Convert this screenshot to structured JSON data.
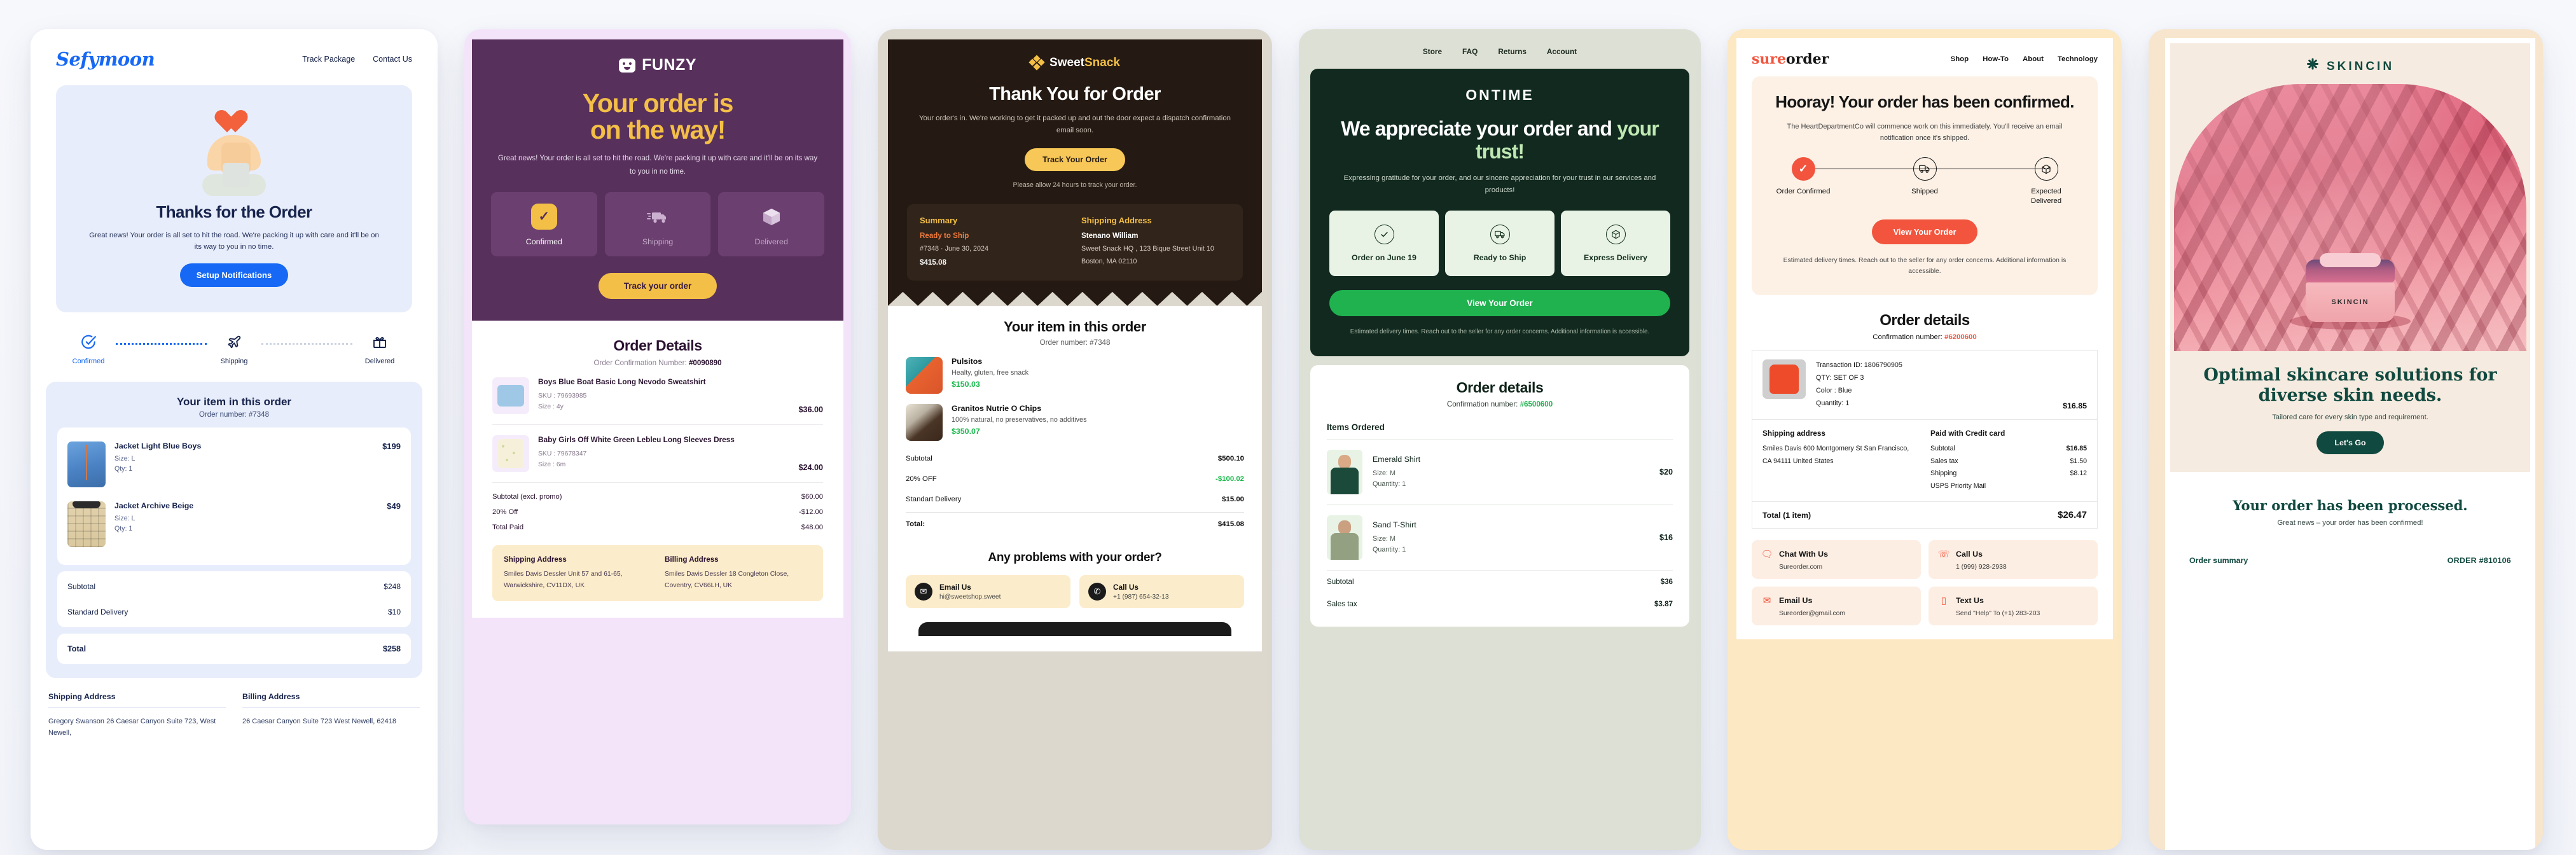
{
  "cards": [
    {
      "brand": "Sefymoon",
      "nav": [
        "Track Package",
        "Contact Us"
      ],
      "hero": {
        "title": "Thanks for the Order",
        "subtitle": "Great news! Your order is all set to hit the road. We're packing it up with care and it'll be on its way to you in no time.",
        "cta": "Setup Notifications"
      },
      "tracker": [
        {
          "label": "Confirmed",
          "icon": "check-circle-icon",
          "state": "active"
        },
        {
          "label": "Shipping",
          "icon": "airplane-icon",
          "state": "pending"
        },
        {
          "label": "Delivered",
          "icon": "gift-icon",
          "state": "pending"
        }
      ],
      "items_section": {
        "title": "Your item in this order",
        "order_number": "Order number: #7348",
        "items": [
          {
            "name": "Jacket Light Blue Boys",
            "size": "Size: L",
            "qty": "Qty: 1",
            "price": "$199"
          },
          {
            "name": "Jacket Archive Beige",
            "size": "Size: L",
            "qty": "Qty: 1",
            "price": "$49"
          }
        ],
        "summary": [
          {
            "label": "Subtotal",
            "value": "$248"
          },
          {
            "label": "Standard Delivery",
            "value": "$10"
          }
        ],
        "total": {
          "label": "Total",
          "value": "$258"
        }
      },
      "addresses": {
        "shipping_heading": "Shipping Address",
        "shipping_body": "Gregory Swanson 26 Caesar Canyon Suite 723, West Newell,",
        "billing_heading": "Billing Address",
        "billing_body": "26 Caesar Canyon Suite 723 West Newell, 62418"
      }
    },
    {
      "brand": "FUNZY",
      "hero": {
        "title_line1": "Your order is",
        "title_line2": "on the way!",
        "subtitle": "Great news! Your order is all set to hit the road. We're packing it up with care and it'll be on its way to you in no time.",
        "cta": "Track your order"
      },
      "steps": [
        {
          "label": "Confirmed",
          "icon": "check-square-icon",
          "state": "active"
        },
        {
          "label": "Shipping",
          "icon": "truck-icon",
          "state": "pending"
        },
        {
          "label": "Delivered",
          "icon": "box-icon",
          "state": "pending"
        }
      ],
      "details": {
        "title": "Order Details",
        "confirmation_label": "Order Confirmation Number:",
        "confirmation_number": "#0090890",
        "items": [
          {
            "name": "Boys Blue Boat Basic Long Nevodo Sweatshirt",
            "sku": "SKU : 79693985",
            "size": "Size : 4y",
            "price": "$36.00"
          },
          {
            "name": "Baby Girls Off White Green Lebleu Long Sleeves Dress",
            "sku": "SKU : 79678347",
            "size": "Size : 6m",
            "price": "$24.00"
          }
        ],
        "summary": [
          {
            "label": "Subtotal (excl. promo)",
            "value": "$60.00"
          },
          {
            "label": "20% Off",
            "value": "-$12.00"
          },
          {
            "label": "Total Paid",
            "value": "$48.00"
          }
        ]
      },
      "addresses": {
        "shipping_heading": "Shipping Address",
        "shipping_body": "Smiles Davis Dessler Unit 57 and 61-65, Warwickshire, CV11DX, UK",
        "billing_heading": "Billing Address",
        "billing_body": "Smiles Davis Dessler 18 Congleton Close, Coventry, CV66LH, UK"
      }
    },
    {
      "brand_part1": "Sweet",
      "brand_part2": "Snack",
      "hero": {
        "title": "Thank You for Order",
        "subtitle": "Your order's in. We're working to get it packed up and out the door expect a dispatch confirmation email soon.",
        "cta": "Track Your Order",
        "note": "Please allow 24 hours to track your order."
      },
      "panel": {
        "summary_heading": "Summary",
        "status": "Ready to Ship",
        "order_line": "#7348 · June 30, 2024",
        "amount": "$415.08",
        "shipping_heading": "Shipping Address",
        "recipient": "Stenano William",
        "address_line1": "Sweet Snack HQ , 123 Bique Street Unit 10",
        "address_line2": "Boston, MA 02110"
      },
      "items_section": {
        "title": "Your item in this order",
        "order_number": "Order number: #7348",
        "items": [
          {
            "name": "Pulsitos",
            "desc": "Healty, gluten, free snack",
            "price": "$150.03"
          },
          {
            "name": "Granitos Nutrie O Chips",
            "desc": "100% natural, no preservatives, no additives",
            "price": "$350.07"
          }
        ],
        "summary": [
          {
            "label": "Subtotal",
            "value": "$500.10",
            "green": false
          },
          {
            "label": "20% OFF",
            "value": "-$100.02",
            "green": true
          },
          {
            "label": "Standart Delivery",
            "value": "$15.00",
            "green": false
          }
        ],
        "total": {
          "label": "Total:",
          "value": "$415.08"
        }
      },
      "help": {
        "title": "Any problems with your order?",
        "contacts": [
          {
            "icon": "envelope-icon",
            "title": "Email Us",
            "value": "hi@sweetshop.sweet"
          },
          {
            "icon": "phone-icon",
            "title": "Call Us",
            "value": "+1 (987) 654-32-13"
          }
        ]
      }
    },
    {
      "brand": "ONTIME",
      "nav": [
        "Store",
        "FAQ",
        "Returns",
        "Account"
      ],
      "hero": {
        "title_plain": "We appreciate your order and ",
        "title_accent": "your trust!",
        "subtitle": "Expressing gratitude for your order, and our sincere appreciation for your trust in our services and products!",
        "cta": "View Your Order",
        "note": "Estimated delivery times. Reach out to the seller for any order concerns. Additional information is accessible."
      },
      "steps": [
        {
          "label": "Order on June 19",
          "icon": "check-circle-icon"
        },
        {
          "label": "Ready to Ship",
          "icon": "truck-circle-icon"
        },
        {
          "label": "Express Delivery",
          "icon": "box-circle-icon"
        }
      ],
      "details": {
        "title": "Order details",
        "confirmation_label": "Confirmation number:",
        "confirmation_number": "#6500600",
        "section_heading": "Items Ordered",
        "items": [
          {
            "name": "Emerald Shirt",
            "size": "Size: M",
            "qty": "Quantity: 1",
            "price": "$20"
          },
          {
            "name": "Sand T-Shirt",
            "size": "Size: M",
            "qty": "Quantity: 1",
            "price": "$16"
          }
        ],
        "summary": [
          {
            "label": "Subtotal",
            "value": "$36"
          },
          {
            "label": "Sales tax",
            "value": "$3.87"
          }
        ]
      }
    },
    {
      "brand_part1": "sure",
      "brand_part2": "order",
      "nav": [
        "Shop",
        "How-To",
        "About",
        "Technology"
      ],
      "hero": {
        "title": "Hooray! Your order has been confirmed.",
        "subtitle": "The HeartDepartmentCo will commence work on this immediately. You'll receive an email notification once it's shipped.",
        "cta": "View Your Order",
        "note": "Estimated delivery times. Reach out to the seller for any order concerns. Additional information is accessible."
      },
      "tracker": [
        {
          "label": "Order Confirmed",
          "icon": "check-icon",
          "state": "done"
        },
        {
          "label": "Shipped",
          "icon": "truck-icon",
          "state": "open"
        },
        {
          "label": "Expected Delivered",
          "icon": "box-icon",
          "state": "open"
        }
      ],
      "details": {
        "title": "Order details",
        "confirmation_label": "Confirmation number:",
        "confirmation_number": "#6200600",
        "product": {
          "transaction": "Transaction ID: 1806790905",
          "qty_set": "QTY: SET OF 3",
          "color": "Color : Blue",
          "quantity": "Quantity: 1",
          "price": "$16.85"
        },
        "shipping_heading": "Shipping address",
        "shipping_lines": "Smiles Davis 600 Montgomery St San Francisco, CA 94111 United States",
        "payment_heading": "Paid with Credit card",
        "payment_rows": [
          {
            "label": "Subtotal",
            "value": "$16.85"
          },
          {
            "label": "Sales tax",
            "value": "$1.50"
          },
          {
            "label": "Shipping",
            "value": "$8.12"
          },
          {
            "label": "USPS Priority Mail",
            "value": ""
          }
        ],
        "total_label": "Total (1 item)",
        "total_value": "$26.47"
      },
      "contacts": [
        {
          "icon": "chat-icon",
          "title": "Chat With Us",
          "value": "Sureorder.com"
        },
        {
          "icon": "headset-icon",
          "title": "Call Us",
          "value": "1 (999) 928-2938"
        },
        {
          "icon": "envelope-icon",
          "title": "Email Us",
          "value": "Sureorder@gmail.com"
        },
        {
          "icon": "phone-device-icon",
          "title": "Text Us",
          "value": "Send \"Help\" To (+1) 283-203"
        }
      ]
    },
    {
      "brand": "SKINCIN",
      "product_label": "SKINCIN",
      "hero": {
        "title": "Optimal skincare solutions for diverse skin needs.",
        "subtitle": "Tailored care for every skin type and requirement.",
        "cta": "Let's Go"
      },
      "footer": {
        "heading": "Your order has been processed.",
        "subheading": "Great news – your order has been confirmed!",
        "summary_label": "Order summary",
        "order_id": "ORDER #810106"
      }
    }
  ],
  "colors": {
    "sefymoon_blue": "#1668f5",
    "funzy_purple": "#58305c",
    "funzy_yellow": "#f3bf46",
    "sweetsnack_dark": "#241a13",
    "sweetsnack_yellow": "#f7c757",
    "ontime_green": "#11291f",
    "ontime_cta": "#1fb24f",
    "sureorder_red": "#f2543d",
    "skincin_green": "#10493f"
  }
}
